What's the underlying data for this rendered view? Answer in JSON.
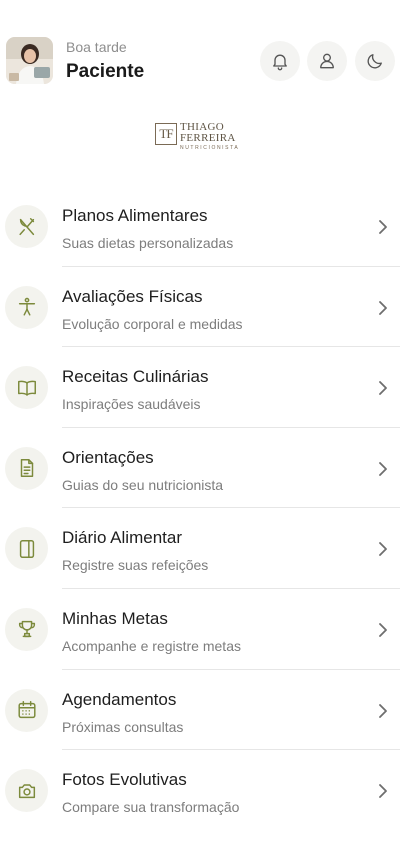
{
  "header": {
    "greeting": "Boa tarde",
    "name": "Paciente",
    "avatar_icon": "avatar-photo",
    "actions": [
      {
        "icon": "bell-icon"
      },
      {
        "icon": "user-icon"
      },
      {
        "icon": "moon-icon"
      }
    ]
  },
  "logo": {
    "monogram": "TF",
    "line1": "THIAGO",
    "line2": "FERREIRA",
    "subtitle": "NUTRICIONISTA"
  },
  "colors": {
    "accent": "#7c8a3c",
    "icon_bg": "#f3f3ee",
    "divider": "#e6e6e6"
  },
  "menu": {
    "items": [
      {
        "title": "Planos Alimentares",
        "subtitle": "Suas dietas personalizadas",
        "icon": "utensils-icon"
      },
      {
        "title": "Avaliações Físicas",
        "subtitle": "Evolução corporal e medidas",
        "icon": "body-icon"
      },
      {
        "title": "Receitas Culinárias",
        "subtitle": "Inspirações saudáveis",
        "icon": "book-icon"
      },
      {
        "title": "Orientações",
        "subtitle": "Guias do seu nutricionista",
        "icon": "document-icon"
      },
      {
        "title": "Diário Alimentar",
        "subtitle": "Registre suas refeições",
        "icon": "journal-icon"
      },
      {
        "title": "Minhas Metas",
        "subtitle": "Acompanhe e registre metas",
        "icon": "trophy-icon"
      },
      {
        "title": "Agendamentos",
        "subtitle": "Próximas consultas",
        "icon": "calendar-icon"
      },
      {
        "title": "Fotos Evolutivas",
        "subtitle": "Compare sua transformação",
        "icon": "camera-icon"
      }
    ]
  }
}
